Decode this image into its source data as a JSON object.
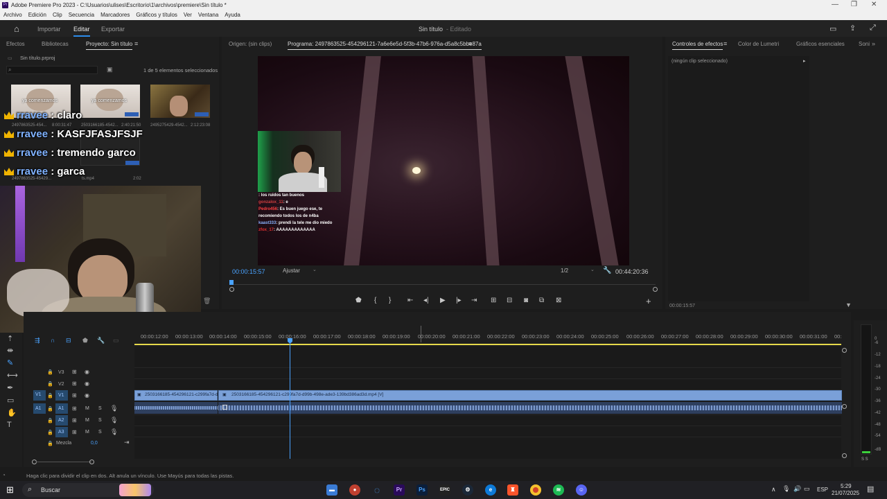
{
  "window": {
    "title": "Adobe Premiere Pro 2023 - C:\\Usuarios\\ulises\\Escritorio\\1\\archivos\\premiere\\Sin título *",
    "app_icon": "Pr"
  },
  "menu": [
    "Archivo",
    "Edición",
    "Clip",
    "Secuencia",
    "Marcadores",
    "Gráficos y títulos",
    "Ver",
    "Ventana",
    "Ayuda"
  ],
  "workspace": {
    "tabs": [
      "Importar",
      "Editar",
      "Exportar"
    ],
    "active_tab": "Editar",
    "project_title": "Sin título",
    "project_status": "- Editado"
  },
  "project_panel": {
    "tabs": [
      "Efectos",
      "Bibliotecas",
      "Proyecto: Sin título"
    ],
    "file_name": "Sin título.prproj",
    "selection_info": "1 de 5 elementos seleccionados",
    "thumbnails": [
      {
        "caption_left": "2497863525-454...",
        "caption_right": "",
        "overlay": "ya comenzamos"
      },
      {
        "caption_left": "2503166185-4542...",
        "caption_right": "2:40:21:50",
        "overlay": "ya comenzamos"
      },
      {
        "caption_left": "2495275429-4542...",
        "caption_right": "2:12:23:08",
        "overlay": ""
      },
      {
        "caption_left": "2497863525-45429...",
        "caption_right": "",
        "overlay": ""
      },
      {
        "caption_left": "ts.mp4",
        "caption_right": "2:02",
        "overlay": ""
      }
    ],
    "thumb_duration_1": "8:00:31:47"
  },
  "chat_overlay": [
    {
      "user": "rravee",
      "msg": " : claro"
    },
    {
      "user": "rravee",
      "msg": " : KASFJFASJFSJF"
    },
    {
      "user": "rravee",
      "msg": " : tremendo garco"
    },
    {
      "user": "rravee",
      "msg": " : garca"
    }
  ],
  "source_monitor": {
    "tab": "Origen: (sin clips)"
  },
  "program_monitor": {
    "tab": "Programa: 2497863525-454296121-7a6e6e5d-5f3b-47b6-976a-d5a8c5bbe87a",
    "timecode": "00:00:15:57",
    "fit": "Ajustar",
    "resolution": "1/2",
    "duration": "00:44:20:36",
    "inner_chat": [
      {
        "user": "",
        "msg": ": los ruidos tan buenos"
      },
      {
        "user": "gonzalox_11",
        "msg": ": e"
      },
      {
        "user": "Pedro456",
        "msg": ": Es buen juego ese, te recomiendo todos los de n4ba"
      },
      {
        "user": "kaast333",
        "msg": ": prendi la tele me dio miedo"
      },
      {
        "user": "zfox_17",
        "msg": ": AAAAAAAAAAAAA"
      }
    ]
  },
  "effects_panel": {
    "tabs": [
      "Controles de efectos",
      "Color de Lumetri",
      "Gráficos esenciales",
      "Soni"
    ],
    "empty_text": "(ningún clip seleccionado)",
    "timecode": "00:00:15:57"
  },
  "timeline": {
    "ruler": [
      "00:00:12:00",
      "00:00:13:00",
      "00:00:14:00",
      "00:00:15:00",
      "00:00:16:00",
      "00:00:17:00",
      "00:00:18:00",
      "00:00:19:00",
      "00:00:20:00",
      "00:00:21:00",
      "00:00:22:00",
      "00:00:23:00",
      "00:00:24:00",
      "00:00:25:00",
      "00:00:26:00",
      "00:00:27:00",
      "00:00:28:00",
      "00:00:29:00",
      "00:00:30:00",
      "00:00:31:00",
      "00:"
    ],
    "tracks": [
      "V3",
      "V2",
      "V1",
      "A1",
      "A2",
      "A3"
    ],
    "mix_label": "Mezcla",
    "mix_value": "0,0",
    "clip1": "2503166185-454296121-c299fa7d-d9",
    "clip2": "2503166185-454296121-c299fa7d-d99b-498e-ade3-139bd386ad3d.mp4 [V]",
    "meter_scale": [
      "0",
      "-6",
      "-12",
      "-18",
      "-24",
      "-30",
      "-36",
      "-42",
      "-48",
      "-54",
      "-dB"
    ],
    "meter_solo": "S S"
  },
  "status_bar": "Haga clic para dividir el clip en dos. Alt anula un vínculo. Use Mayús para todas las pistas.",
  "taskbar": {
    "search": "Buscar",
    "lang": "ESP",
    "time": "5:29",
    "date": "21/07/2025"
  },
  "colors": {
    "accent": "#2d8ceb",
    "clip_video": "#7aa0d8",
    "clip_audio": "#2e3f5e",
    "playhead": "#4aa3ff"
  }
}
